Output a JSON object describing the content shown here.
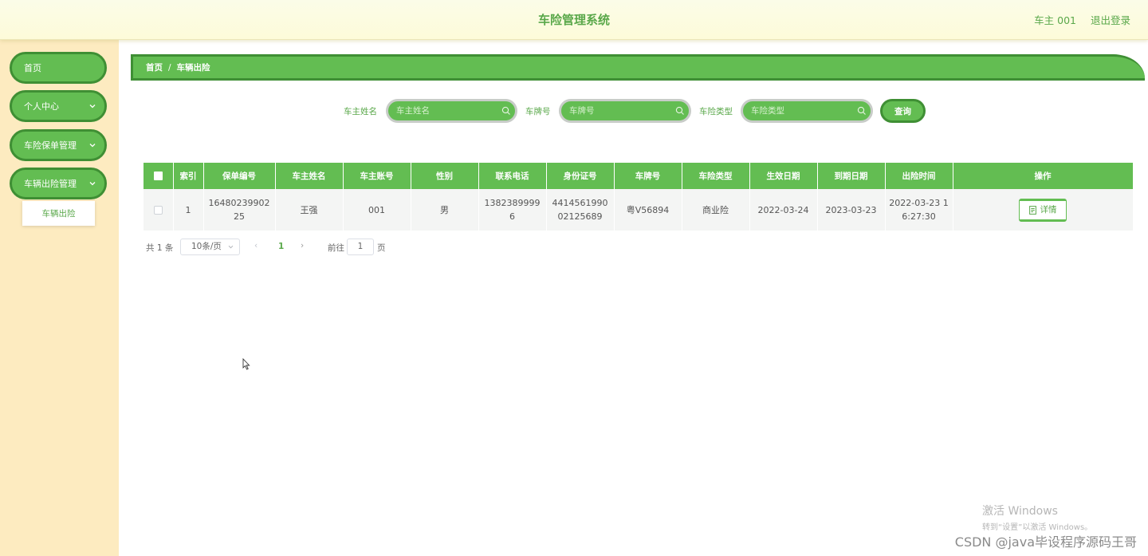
{
  "header": {
    "title": "车险管理系统",
    "user": "车主 001",
    "logout": "退出登录"
  },
  "sidebar": {
    "items": [
      {
        "label": "首页"
      },
      {
        "label": "个人中心"
      },
      {
        "label": "车险保单管理"
      },
      {
        "label": "车辆出险管理"
      }
    ],
    "submenu": {
      "label": "车辆出险"
    }
  },
  "breadcrumb": {
    "home": "首页",
    "sep": "/",
    "current": "车辆出险"
  },
  "search": {
    "owner_label": "车主姓名",
    "owner_placeholder": "车主姓名",
    "plate_label": "车牌号",
    "plate_placeholder": "车牌号",
    "type_label": "车险类型",
    "type_placeholder": "车险类型",
    "query_button": "查询"
  },
  "table": {
    "headers": [
      "索引",
      "保单编号",
      "车主姓名",
      "车主账号",
      "性别",
      "联系电话",
      "身份证号",
      "车牌号",
      "车险类型",
      "生效日期",
      "到期日期",
      "出险时间",
      "操作"
    ],
    "rows": [
      {
        "index": "1",
        "policy_no": "1648023990225",
        "owner": "王强",
        "account": "001",
        "gender": "男",
        "phone": "13823899996",
        "id_no": "441456199002125689",
        "plate": "粤V56894",
        "type": "商业险",
        "start": "2022-03-24",
        "end": "2023-03-23",
        "incident_time": "2022-03-23 16:27:30",
        "action": "详情"
      }
    ]
  },
  "pagination": {
    "total": "共 1 条",
    "page_size": "10条/页",
    "current_page": "1",
    "goto_label": "前往",
    "goto_value": "1",
    "page_unit": "页"
  },
  "watermark": {
    "activate_title": "激活 Windows",
    "activate_sub": "转到“设置”以激活 Windows。",
    "csdn": "CSDN @java毕设程序源码王哥"
  },
  "colors": {
    "primary": "#63bd52",
    "primary_dark": "#3f8f34",
    "sidebar_bg": "#fdebc0",
    "header_bg": "#fdfbdf"
  }
}
